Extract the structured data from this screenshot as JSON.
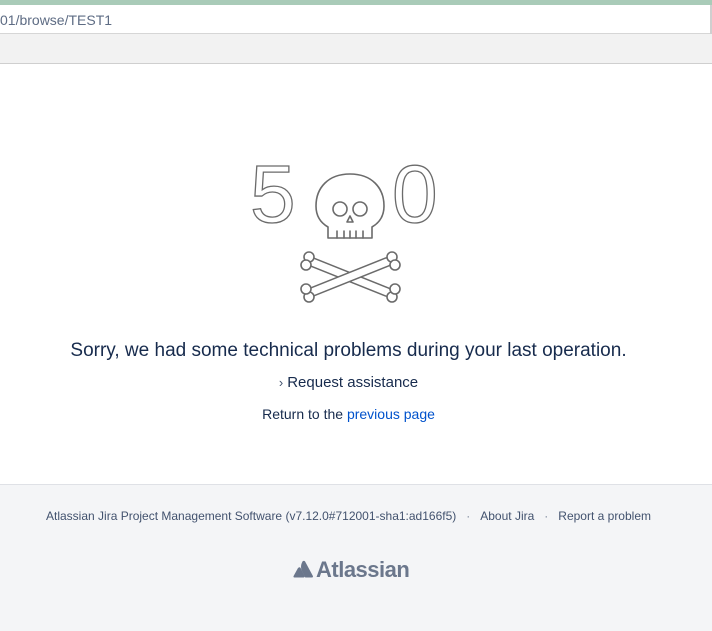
{
  "browser": {
    "url": "01/browse/TEST1"
  },
  "error": {
    "code_left_digit": "5",
    "code_right_digit": "0",
    "message": "Sorry, we had some technical problems during your last operation.",
    "request_assistance_label": "Request assistance",
    "return_prefix": "Return to the",
    "previous_page_label": "previous page"
  },
  "footer": {
    "software_label": "Atlassian Jira Project Management Software (v7.12.0#712001-sha1:ad166f5)",
    "separator": "·",
    "about_label": "About Jira",
    "report_label": "Report a problem",
    "brand_label": "Atlassian"
  },
  "icons": {
    "skull": "skull-crossbones-icon",
    "atlassian": "atlassian-logo-icon",
    "chevron": "chevron-right-icon"
  }
}
